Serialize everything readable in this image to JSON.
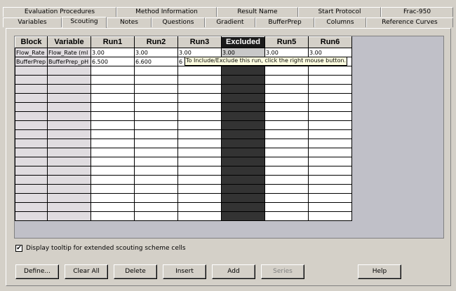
{
  "tabs_top": [
    {
      "label": "Evaluation Procedures",
      "w": 0
    },
    {
      "label": "Method Information"
    },
    {
      "label": "Result Name"
    },
    {
      "label": "Start Protocol"
    },
    {
      "label": "Frac-950"
    }
  ],
  "tabs_bottom": [
    "Variables",
    "Scouting",
    "Notes",
    "Questions",
    "Gradient",
    "BufferPrep",
    "Columns",
    "Reference Curves"
  ],
  "active_tab": "Scouting",
  "grid": {
    "headers": [
      "Block",
      "Variable",
      "Run1",
      "Run2",
      "Run3",
      "Excluded",
      "Run5",
      "Run6"
    ],
    "excluded_column_index": 5,
    "rows": [
      [
        "Flow_Rate",
        "Flow_Rate (ml",
        "3.00",
        "3.00",
        "3.00",
        "3.00",
        "3.00",
        "3.00"
      ],
      [
        "BufferPrep",
        "BufferPrep_pH",
        "6.500",
        "6.600",
        "6",
        "",
        "",
        ""
      ]
    ],
    "empty_row_count": 17
  },
  "tooltip": "To Include/Exclude this run, click the right mouse button.",
  "display_tooltip_checkbox": {
    "label": "Display tooltip for extended scouting scheme cells",
    "checked": true
  },
  "buttons": {
    "define": "Define...",
    "clear_all": "Clear All",
    "delete": "Delete",
    "insert": "Insert",
    "add": "Add",
    "series": "Series",
    "help": "Help"
  }
}
